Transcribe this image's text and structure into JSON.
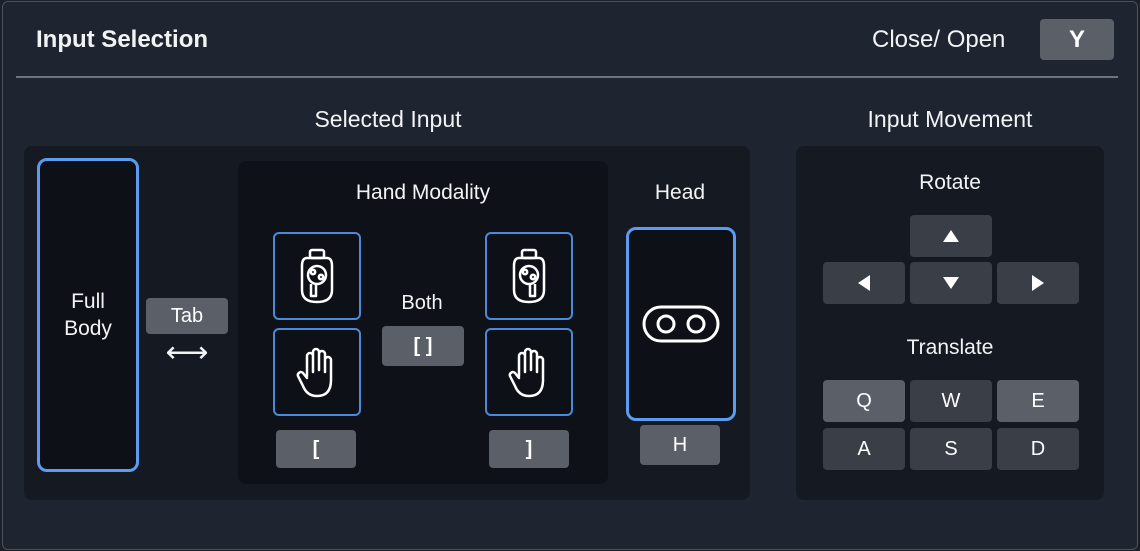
{
  "header": {
    "title": "Input Selection",
    "close_label": "Close/ Open",
    "close_key": "Y"
  },
  "selected_input": {
    "title": "Selected Input",
    "full_body": {
      "line1": "Full",
      "line2": "Body"
    },
    "tab_key": "Tab",
    "swap_glyph": "⟷",
    "hand_modality": {
      "title": "Hand Modality",
      "both_label": "Both",
      "both_key": "[ ]",
      "left_key": "[",
      "right_key": "]"
    },
    "head": {
      "title": "Head",
      "key": "H"
    }
  },
  "input_movement": {
    "title": "Input Movement",
    "rotate_label": "Rotate",
    "translate_label": "Translate",
    "translate_keys": {
      "q": "Q",
      "w": "W",
      "e": "E",
      "a": "A",
      "s": "S",
      "d": "D"
    }
  },
  "colors": {
    "accent": "#5b9cf0",
    "key_active": "#5a5f68",
    "key_idle": "#3a3e46"
  }
}
